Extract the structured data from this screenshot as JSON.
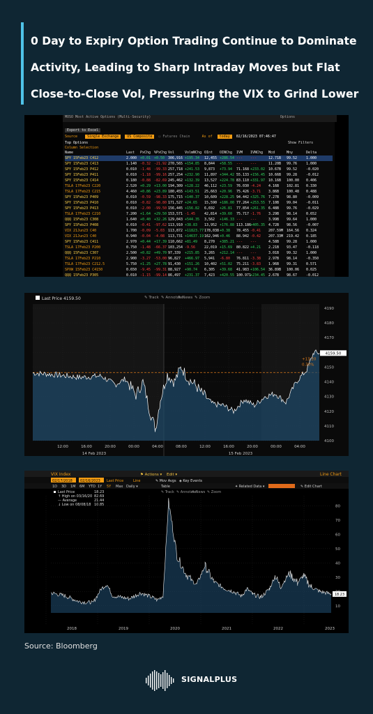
{
  "header": {
    "title_lines": [
      "0 Day to Expiry Option Trading Continue to Dominate",
      "Activity, Leading to Sharp Intraday Moves but Flat",
      "Close-to-Close Vol, Pressuring the VIX to Grind Lower"
    ]
  },
  "options_panel": {
    "window_title": "MOSO Most Active Options (Multi-Security)",
    "window_right": "Options",
    "export_label": "Export to Excel",
    "source_label": "Source",
    "source_value": "Single Exchange",
    "composite_value": "US Composite",
    "futures_chain_label": "Futures Chain",
    "asof_label": "As of",
    "asof_value": "today",
    "datetime": "02/16/2023  07:46:47",
    "top_options_label": "Top Options",
    "show_filters_label": "Show Filters",
    "column_selection_label": "Column Selection",
    "columns": [
      "Name",
      "Last",
      "PxChg",
      "%PxChg",
      "Vol",
      "VolmNChg",
      "OInt",
      "OINChg",
      "IVM",
      "IVNChg",
      "Mcd",
      "Mny",
      "Delta"
    ],
    "rows": [
      [
        "SPY 15Feb23 C412",
        "2.000",
        "+0.01",
        "+0.50",
        "306,916",
        "+195.34",
        "12,455",
        "+286.54",
        "---",
        "---",
        "12.71B",
        "99.52",
        "1.000"
      ],
      [
        "SPY 15Feb23 C413",
        "1.140",
        "-0.32",
        "-21.92",
        "270,565",
        "+154.85",
        "8,844",
        "+58.55",
        "---",
        "---",
        "11.20B",
        "99.76",
        "1.000"
      ],
      [
        "SPY 15Feb23 P412",
        "0.010",
        "-1.48",
        "-99.33",
        "257,718",
        "+241.53",
        "9,873",
        "+73.94",
        "71.168",
        "+233.02",
        "10.67B",
        "99.52",
        "-0.020"
      ],
      [
        "SPY 15Feb23 P411",
        "0.010",
        "-1.18",
        "-99.16",
        "257,254",
        "+232.90",
        "11,897",
        "+344.42",
        "55.133",
        "+156.45",
        "10.66B",
        "99.28",
        "-0.012"
      ],
      [
        "SPY 15Feb23 C414",
        "0.180",
        "-0.88",
        "-82.69",
        "245,462",
        "+132.39",
        "13,527",
        "+224.78",
        "83.110",
        "+331.97",
        "10.16B",
        "100.00",
        "0.406"
      ],
      [
        "TSLA 17Feb23 C220",
        "2.520",
        "+0.29",
        "+13.00",
        "194,309",
        "+128.22",
        "46,112",
        "+23.59",
        "76.030",
        "-4.24",
        "4.16B",
        "102.81",
        "0.330"
      ],
      [
        "TSLA 17Feb23 C215",
        "4.460",
        "+0.86",
        "+23.89",
        "180,455",
        "+143.51",
        "25,663",
        "+20.96",
        "75.426",
        "-3.71",
        "3.86B",
        "100.48",
        "0.488"
      ],
      [
        "SPY 15Feb23 P409",
        "0.010",
        "-0.59",
        "-98.33",
        "175,715",
        "+140.37",
        "10,609",
        "+228.25",
        "94.442",
        "+325.76",
        "7.27B",
        "98.80",
        "-0.009"
      ],
      [
        "SPY 15Feb23 P410",
        "0.010",
        "-0.82",
        "-98.80",
        "171,527",
        "+24.65",
        "15,590",
        "+186.00",
        "77.264",
        "+253.55",
        "7.10B",
        "99.04",
        "-0.011"
      ],
      [
        "SPY 15Feb23 P413",
        "0.010",
        "-2.00",
        "-99.50",
        "156,445",
        "+156.82",
        "6,692",
        "+26.81",
        "77.854",
        "+261.35",
        "6.48B",
        "99.76",
        "-0.029"
      ],
      [
        "TSLA 17Feb23 C210",
        "7.200",
        "+1.64",
        "+29.50",
        "153,571",
        "-1.45",
        "42,814",
        "+39.60",
        "75.717",
        "-1.76",
        "3.29B",
        "98.14",
        "0.652"
      ],
      [
        "QQQ 15Feb23 C308",
        "1.640",
        "+0.40",
        "+32.26",
        "129,043",
        "+544.35",
        "3,562",
        "+146.33",
        "---",
        "---",
        "3.99B",
        "99.64",
        "1.000"
      ],
      [
        "SPY 15Feb23 P408",
        "0.010",
        "-0.41",
        "-97.62",
        "113,910",
        "+38.83",
        "13,952",
        "+176.88",
        "113.186",
        "+405.35",
        "4.72B",
        "98.56",
        "-0.007"
      ],
      [
        "VIX 21Jun23 C40",
        "1.700",
        "-0.09",
        "-5.03",
        "113,872",
        "+11823.77",
        "178,038",
        "+0.38",
        "78.455",
        "-0.41",
        "207.59M",
        "164.56",
        "0.324"
      ],
      [
        "VIX 21Jun23 C40",
        "0.940",
        "-0.04",
        "-4.08",
        "113,731",
        "+14637.19",
        "162,946",
        "+0.46",
        "88.942",
        "-0.42",
        "207.33M",
        "219.42",
        "0.185"
      ],
      [
        "SPY 15Feb23 C411",
        "2.970",
        "+0.44",
        "+17.39",
        "110,662",
        "+81.49",
        "8,270",
        "+385.21",
        "---",
        "---",
        "4.58B",
        "99.28",
        "1.000"
      ],
      [
        "TSLA 17Feb23 P200",
        "0.750",
        "-1.48",
        "-66.37",
        "103,254",
        "-9.56",
        "22,019",
        "+15.69",
        "80.822",
        "+4.21",
        "2.21B",
        "93.47",
        "-0.118"
      ],
      [
        "QQQ 15Feb23 C307",
        "2.500",
        "+0.82",
        "+49.70",
        "97,339",
        "+215.85",
        "3,265",
        "+212.14",
        "---",
        "---",
        "3.01B",
        "99.32",
        "1.000"
      ],
      [
        "TSLA 17Feb23 P210",
        "2.900",
        "-3.27",
        "-53.00",
        "96,827",
        "+466.97",
        "5,941",
        "-6.80",
        "76.811",
        "-3.38",
        "2.97B",
        "98.14",
        "-0.350"
      ],
      [
        "TSLA 17Feb23 C212.5",
        "5.750",
        "+1.25",
        "+27.78",
        "91,430",
        "+151.26",
        "10,402",
        "+51.02",
        "75.211",
        "-3.83",
        "1.96B",
        "99.31",
        "0.571"
      ],
      [
        "SPXW 15Feb23 C4150",
        "0.650",
        "-9.45",
        "-99.31",
        "88,927",
        "+90.74",
        "6,305",
        "+39.68",
        "41.983",
        "+106.54",
        "36.89B",
        "100.06",
        "0.025"
      ],
      [
        "QQQ 15Feb23 P305",
        "0.010",
        "-1.15",
        "-99.14",
        "86,497",
        "+231.37",
        "7,423",
        "+420.55",
        "100.971",
        "+234.45",
        "2.67B",
        "98.67",
        "-0.012"
      ]
    ]
  },
  "intraday_panel": {
    "legend_label": "Last Price",
    "legend_value": "4159.50",
    "tools": [
      "Track",
      "Annotate",
      "News",
      "Zoom"
    ],
    "y_ticks": [
      "4190",
      "4180",
      "4170",
      "4160",
      "4150",
      "4140",
      "4130",
      "4120",
      "4110",
      "4100"
    ],
    "x_ticks": [
      "12:00",
      "16:00",
      "20:00",
      "00:00",
      "04:00",
      "08:00",
      "12:00",
      "16:00",
      "20:00",
      "00:00",
      "04:00"
    ],
    "date_labels": [
      "14 Feb 2023",
      "15 Feb 2023"
    ],
    "last_tag": "4159.50",
    "change_tag": "+13.20",
    "pct_tag": "0.30%",
    "colors": {
      "line": "#ffffff",
      "fill": "#1e4a6b",
      "ref_line": "#e07b1a",
      "tag": "#ffffff"
    }
  },
  "vix_panel": {
    "ticker": "VIX Index",
    "actions_label": "Actions",
    "edit_label": "Edit",
    "line_chart_label": "Line Chart",
    "date_from": "02/17/2018",
    "date_to": "02/16/2023",
    "last_price_btn": "Last Price",
    "line_label": "Line",
    "move_avgs": "Mov Avgs",
    "key_events": "Key Events",
    "periods": [
      "1D",
      "3D",
      "1M",
      "6M",
      "YTD",
      "1Y",
      "5Y",
      "Max"
    ],
    "freq": "Daily",
    "table_label": "Table",
    "related_label": "Related Data",
    "edit_chart_label": "Edit Chart",
    "legend": {
      "last_label": "Last Price",
      "last_value": "18.23",
      "high_label": "High on 03/16/20",
      "high_value": "82.69",
      "avg_label": "Average",
      "avg_value": "21.44",
      "low_label": "Low on 08/08/18",
      "low_value": "10.85"
    },
    "tools": [
      "Track",
      "Annotate",
      "News",
      "Zoom"
    ],
    "y_ticks": [
      "80",
      "70",
      "60",
      "50",
      "40",
      "30",
      "20",
      "10"
    ],
    "x_ticks": [
      "2018",
      "2019",
      "2020",
      "2021",
      "2022",
      "2023"
    ],
    "last_tag": "18.23"
  },
  "footer": {
    "source": "Source: Bloomberg",
    "brand": "SIGNALPLUS"
  }
}
